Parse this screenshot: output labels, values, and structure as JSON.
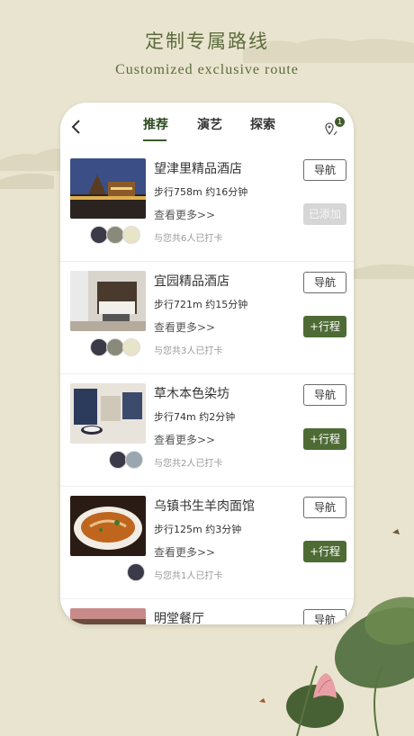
{
  "header": {
    "title_zh": "定制专属路线",
    "title_en": "Customized exclusive route"
  },
  "nav": {
    "tabs": [
      {
        "label": "推荐",
        "active": true
      },
      {
        "label": "演艺",
        "active": false
      },
      {
        "label": "探索",
        "active": false
      }
    ],
    "badge_count": "1",
    "icons": {
      "back": "back-arrow-icon",
      "location": "location-pins-icon"
    }
  },
  "items": [
    {
      "name": "望津里精品酒店",
      "walk": "步行758m 约16分钟",
      "more": "查看更多>>",
      "checkin": "与您共6人已打卡",
      "nav_label": "导航",
      "action_label": "已添加",
      "added": true
    },
    {
      "name": "宜园精品酒店",
      "walk": "步行721m 约15分钟",
      "more": "查看更多>>",
      "checkin": "与您共3人已打卡",
      "nav_label": "导航",
      "action_label": "+行程",
      "added": false
    },
    {
      "name": "草木本色染坊",
      "walk": "步行74m 约2分钟",
      "more": "查看更多>>",
      "checkin": "与您共2人已打卡",
      "nav_label": "导航",
      "action_label": "+行程",
      "added": false
    },
    {
      "name": "乌镇书生羊肉面馆",
      "walk": "步行125m 约3分钟",
      "more": "查看更多>>",
      "checkin": "与您共1人已打卡",
      "nav_label": "导航",
      "action_label": "+行程",
      "added": false
    },
    {
      "name": "明堂餐厅",
      "nav_label": "导航"
    }
  ],
  "colors": {
    "accent": "#4e6b35",
    "background": "#e9e4cf",
    "added_button": "#d6d6d6"
  }
}
